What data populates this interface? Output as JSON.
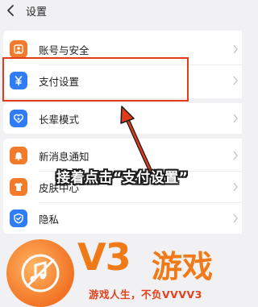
{
  "header": {
    "title": "设置",
    "back_icon": "chevron-left-icon"
  },
  "colors": {
    "highlight": "#e33a17",
    "icon_blue": "#2f7cf6",
    "icon_orange": "#f27a2a",
    "watermark_orange": "#f07a18"
  },
  "settings": {
    "group1": [
      {
        "label": "账号与安全",
        "icon": "account-icon"
      },
      {
        "label": "支付设置",
        "icon": "yen-icon"
      }
    ],
    "group2": [
      {
        "label": "长辈模式",
        "icon": "heart-icon"
      }
    ],
    "group3": [
      {
        "label": "新消息通知",
        "icon": "bell-icon"
      },
      {
        "label": "皮肤中心",
        "icon": "shirt-icon"
      },
      {
        "label": "隐私",
        "icon": "shield-icon"
      }
    ]
  },
  "annotation": {
    "text": "接着点击“支付设置”"
  },
  "watermark": {
    "brand": "V3",
    "brand_cn": "游戏",
    "slogan": "游戏人生，不负VVVV3"
  }
}
